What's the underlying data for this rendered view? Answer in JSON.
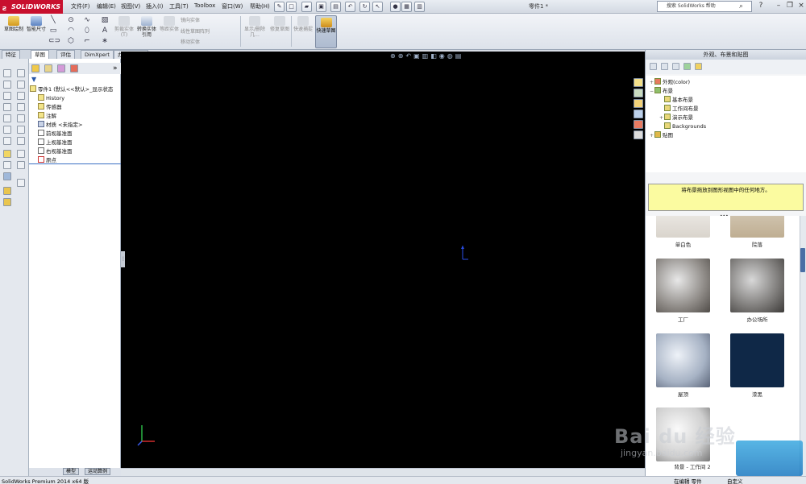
{
  "title_bar": {
    "app_logo": "SOLIDWORKS",
    "menus": [
      "文件(F)",
      "编辑(E)",
      "视图(V)",
      "插入(I)",
      "工具(T)",
      "Toolbox",
      "窗口(W)",
      "帮助(H)"
    ],
    "document_title": "零件1 *",
    "search_placeholder": "搜索 SolidWorks 帮助"
  },
  "ribbon": {
    "sketch": "草图绘制",
    "smart_dim": "智能尺寸",
    "trim": "剪裁实体(T)",
    "convert": "转换实体引用",
    "offset": "等距实体",
    "mirror": "镜向实体",
    "linear_pattern": "线性草图阵列",
    "move": "移动实体",
    "display_delete": "显示/删除几...",
    "repair": "修复草图",
    "rapid": "快速捕捉",
    "quick_sketch": "快速草图"
  },
  "cmd_tabs": [
    "特征",
    "草图",
    "评估",
    "DimXpert",
    "办公室产品"
  ],
  "feature_tree": {
    "root": "零件1 (默认<<默认>_显示状态",
    "items": [
      "History",
      "传感器",
      "注解",
      "材质 <未指定>",
      "前视基准面",
      "上视基准面",
      "右视基准面",
      "原点"
    ]
  },
  "bottom_tabs": [
    "模型",
    "运动算例"
  ],
  "task_pane": {
    "title": "外观、布景和贴图",
    "tree": {
      "appearance": "外观(color)",
      "scenes": "布景",
      "basic": "基本布景",
      "studio": "工作间布景",
      "presentation": "演示布景",
      "backgrounds": "Backgrounds",
      "decals": "贴图"
    },
    "hint": "将布景拖放到图形视图中的任何地方。",
    "gallery": [
      {
        "label": "单白色",
        "color": "#d9d4cc"
      },
      {
        "label": "院落",
        "color": "#bfae92"
      },
      {
        "label": "工厂",
        "color": "#8e8a86"
      },
      {
        "label": "办公场所",
        "color": "#7c7a78"
      },
      {
        "label": "屋顶",
        "color": "#a6b2c4"
      },
      {
        "label": "漆黑",
        "color": "#0f2847"
      },
      {
        "label": "背景 - 工作间 2",
        "color": "#cfcfcf"
      }
    ]
  },
  "status_bar": {
    "product": "SolidWorks Premium 2014 x64 版",
    "mode": "在编辑 零件",
    "custom": "自定义"
  },
  "watermark": {
    "main": "Bai du 经验",
    "sub": "jingyan.baidu.com"
  },
  "accent_color": "#c8102e"
}
